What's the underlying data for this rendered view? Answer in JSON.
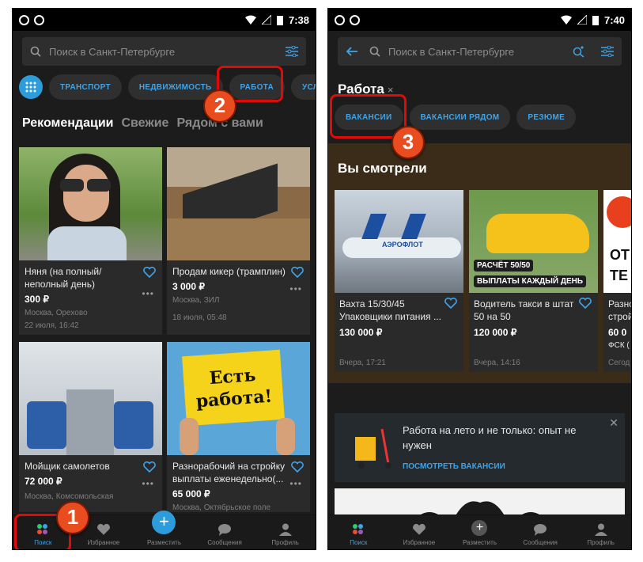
{
  "left": {
    "status": {
      "time": "7:38"
    },
    "search": {
      "placeholder": "Поиск в Санкт-Петербурге"
    },
    "chips": [
      "ТРАНСПОРТ",
      "НЕДВИЖИМОСТЬ",
      "РАБОТА",
      "УСЛУ"
    ],
    "tabs": [
      "Рекомендации",
      "Свежие",
      "Рядом с вами"
    ],
    "cards": [
      {
        "title": "Няня (на полный/ неполный день)",
        "price": "300 ₽",
        "location": "Москва, Орехово",
        "date": "22 июля, 16:42"
      },
      {
        "title": "Продам кикер (трамплин)",
        "price": "3 000 ₽",
        "location": "Москва, ЗИЛ",
        "date": "18 июля, 05:48"
      },
      {
        "title": "Мойщик самолетов",
        "price": "72 000 ₽",
        "location": "Москва, Комсомольская",
        "date": ""
      },
      {
        "title": "Разнорабочий на стройку выплаты еженедельно(...",
        "price": "65 000 ₽",
        "location": "Москва, Октябрьское поле",
        "date": ""
      }
    ],
    "sign_text_1": "Есть",
    "sign_text_2": "работа!",
    "badges": [
      "1",
      "2"
    ]
  },
  "right": {
    "status": {
      "time": "7:40"
    },
    "search": {
      "placeholder": "Поиск в Санкт-Петербурге"
    },
    "breadcrumb": {
      "label": "Работа",
      "close": "×"
    },
    "chips": [
      "ВАКАНСИИ",
      "ВАКАНСИИ РЯДОМ",
      "РЕЗЮМЕ"
    ],
    "section_title": "Вы смотрели",
    "cards": [
      {
        "title": "Вахта 15/30/45 Упаковщики питания ...",
        "price": "130 000 ₽",
        "date": "Вчера, 17:21",
        "img_text": "АЭРОФЛОТ"
      },
      {
        "title": "Водитель такси в штат 50 на 50",
        "price": "120 000 ₽",
        "date": "Вчера, 14:16",
        "img_label_1": "РАСЧЁТ 50/50",
        "img_label_2": "ВЫПЛАТЫ КАЖДЫЙ ДЕНЬ"
      },
      {
        "title": "Разно строй",
        "price": "60 0",
        "extra": "ФСК (",
        "date": "Сегод",
        "img_text_1": "ОТ",
        "img_text_2": "ТЕ"
      }
    ],
    "promo": {
      "text": "Работа на лето и не только: опыт не нужен",
      "link": "ПОСМОТРЕТЬ ВАКАНСИИ",
      "close": "✕"
    },
    "badge": "3"
  },
  "nav": [
    "Поиск",
    "Избранное",
    "Разместить",
    "Сообщения",
    "Профиль"
  ],
  "colors": {
    "accent": "#3fa3e8",
    "annotation": "#e84c1f",
    "background": "#1c1c1c"
  }
}
